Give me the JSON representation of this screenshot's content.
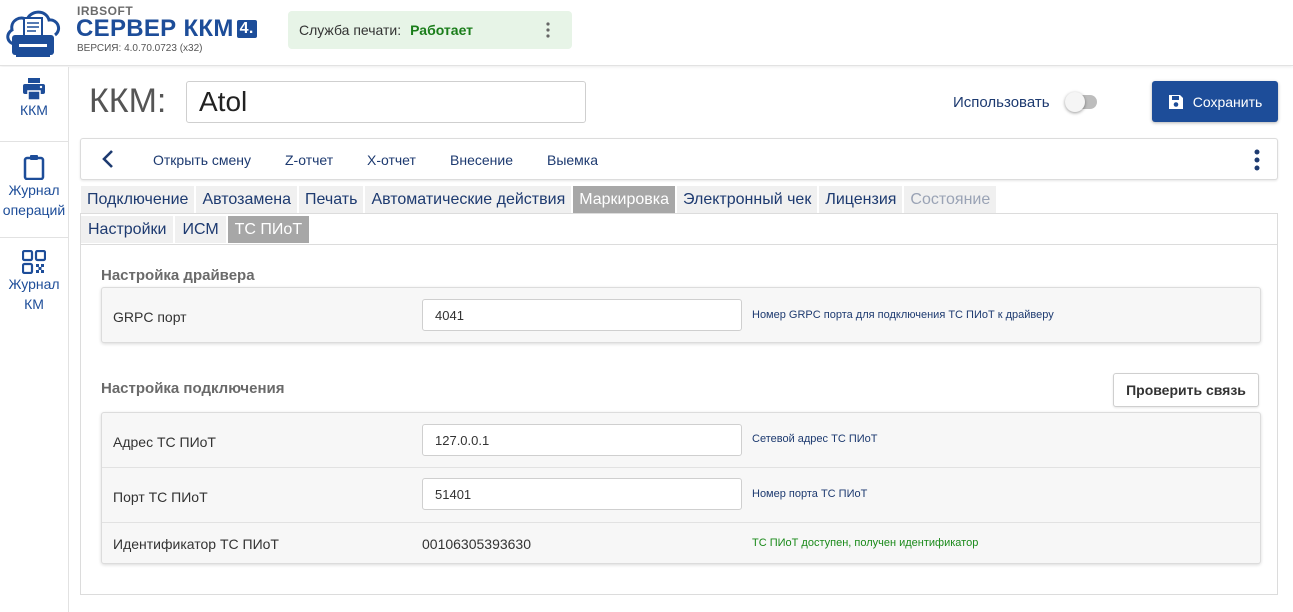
{
  "header": {
    "brand_top": "IRBSOFT",
    "brand_main": "СЕРВЕР ККМ",
    "brand_ver": "4.",
    "version": "ВЕРСИЯ: 4.0.70.0723 (x32)",
    "print_service_label": "Служба печати:",
    "print_service_status": "Работает"
  },
  "sidebar": {
    "items": [
      {
        "label": "ККМ",
        "icon": "printer-icon"
      },
      {
        "label": "Журнал операций",
        "icon": "clipboard-icon"
      },
      {
        "label": "Журнал КМ",
        "icon": "qr-code-icon"
      }
    ]
  },
  "main": {
    "title": "ККМ:",
    "kkm_name": "Atol",
    "use_label": "Использовать",
    "use_enabled": false,
    "save_label": "Сохранить"
  },
  "actions": [
    "Открыть смену",
    "Z-отчет",
    "X-отчет",
    "Внесение",
    "Выемка"
  ],
  "tabs": [
    {
      "label": "Подключение",
      "state": "normal"
    },
    {
      "label": "Автозамена",
      "state": "normal"
    },
    {
      "label": "Печать",
      "state": "normal"
    },
    {
      "label": "Автоматические действия",
      "state": "normal"
    },
    {
      "label": "Маркировка",
      "state": "active"
    },
    {
      "label": "Электронный чек",
      "state": "normal"
    },
    {
      "label": "Лицензия",
      "state": "normal"
    },
    {
      "label": "Состояние",
      "state": "disabled"
    }
  ],
  "subtabs": [
    {
      "label": "Настройки",
      "state": "normal"
    },
    {
      "label": "ИСМ",
      "state": "normal"
    },
    {
      "label": "ТС ПИоТ",
      "state": "active"
    }
  ],
  "driver_section": {
    "title": "Настройка драйвера",
    "grpc_label": "GRPC порт",
    "grpc_value": "4041",
    "grpc_hint": "Номер GRPC порта для подключения ТС ПИоТ к драйверу"
  },
  "connection_section": {
    "title": "Настройка подключения",
    "check_button": "Проверить связь",
    "address_label": "Адрес ТС ПИоТ",
    "address_value": "127.0.0.1",
    "address_hint": "Сетевой адрес ТС ПИоТ",
    "port_label": "Порт ТС ПИоТ",
    "port_value": "51401",
    "port_hint": "Номер порта ТС ПИоТ",
    "id_label": "Идентификатор ТС ПИоТ",
    "id_value": "00106305393630",
    "id_status": "ТС ПИоТ доступен, получен идентификатор"
  },
  "colors": {
    "brand": "#1d4d99",
    "status_ok": "#1a7d1a",
    "tab_active": "#a7a7a7"
  }
}
